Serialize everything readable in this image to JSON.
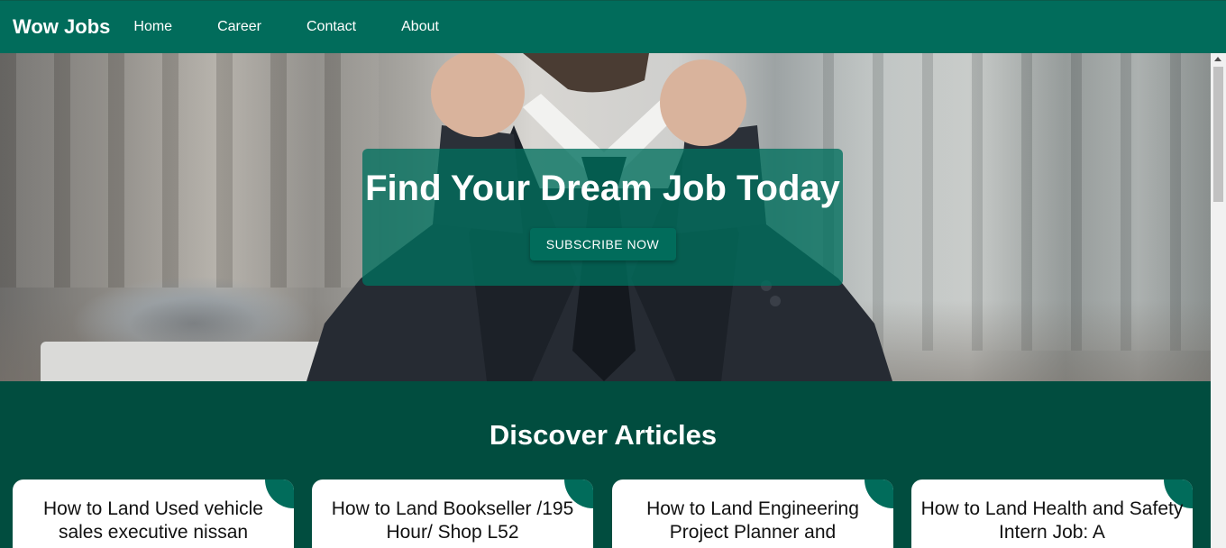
{
  "navbar": {
    "brand": "Wow Jobs",
    "links": [
      "Home",
      "Career",
      "Contact",
      "About"
    ]
  },
  "hero": {
    "title": "Find Your Dream Job Today",
    "button_label": "SUBSCRIBE NOW"
  },
  "articles": {
    "heading": "Discover Articles",
    "cards": [
      {
        "title": "How to Land Used vehicle sales executive nissan"
      },
      {
        "title": "How to Land Bookseller /195 Hour/ Shop L52"
      },
      {
        "title": "How to Land Engineering Project Planner and"
      },
      {
        "title": "How to Land Health and Safety Intern Job: A"
      }
    ]
  },
  "colors": {
    "nav_bg": "#016c5b",
    "section_bg": "#014d3f",
    "hero_overlay": "#00705e",
    "card_bg": "#ffffff"
  }
}
